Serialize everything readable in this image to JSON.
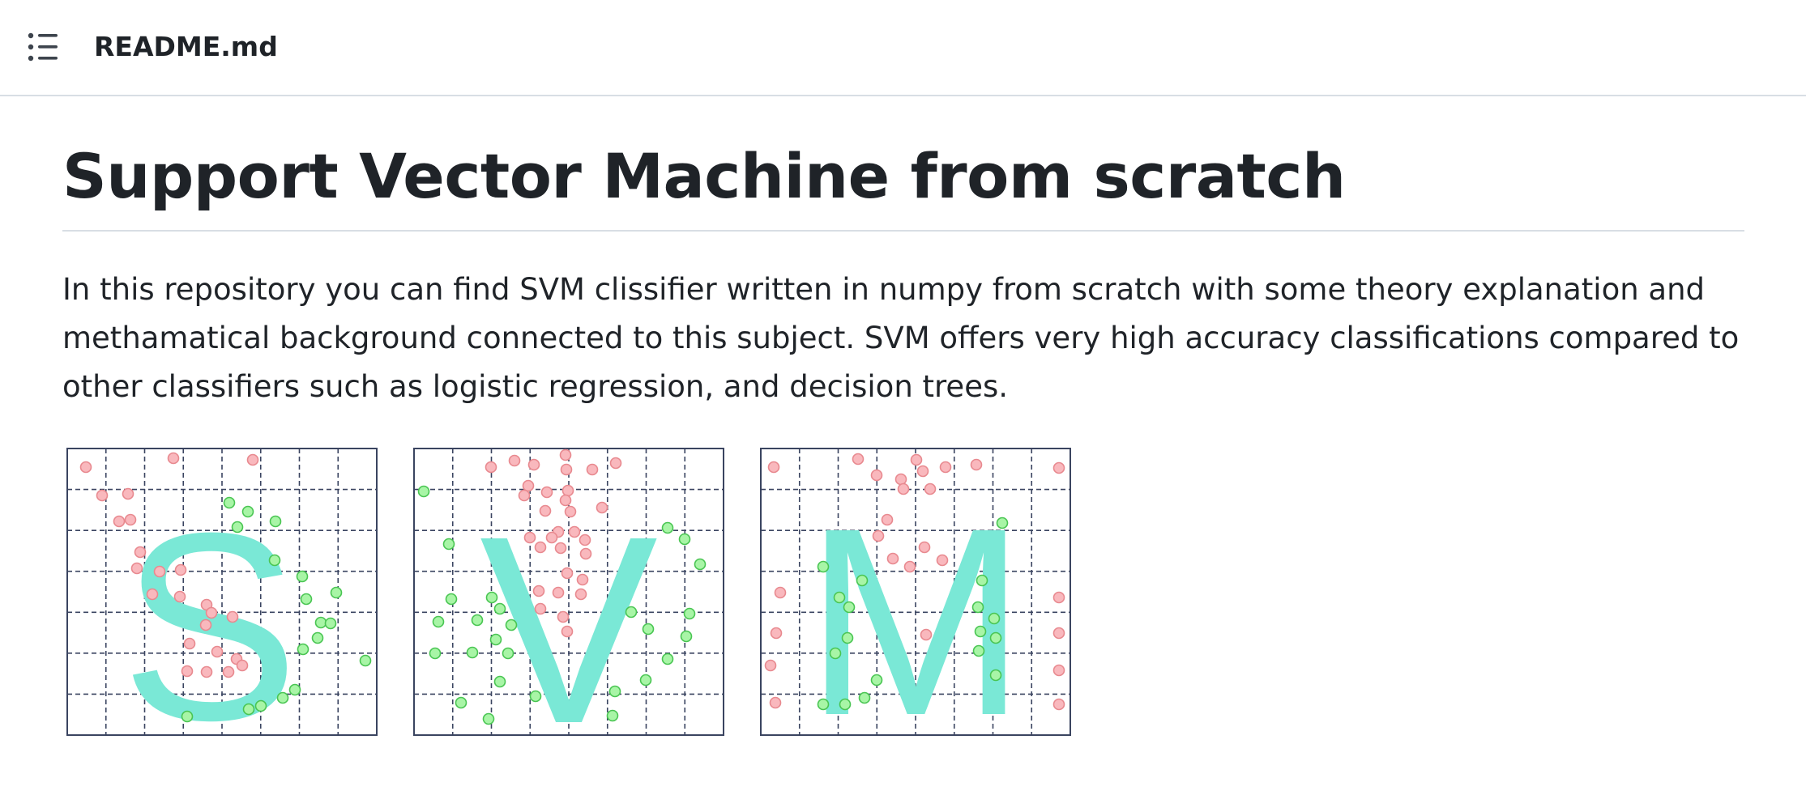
{
  "header": {
    "toc_icon": "list-icon",
    "file_name": "README.md"
  },
  "readme": {
    "title": "Support Vector Machine from scratch",
    "description": "In this repository you can find SVM clissifier written in numpy from scratch with some theory explanation and methamatical background connected to this subject. SVM offers very high accuracy classifications compared to other classifiers such as logistic regression, and decision trees.",
    "banner": {
      "letters": [
        "S",
        "V",
        "M"
      ],
      "colors": {
        "letter": "#7ae8d6",
        "class_a_fill": "#f9b8bd",
        "class_a_stroke": "#e8898f",
        "class_b_fill": "#a8f5a6",
        "class_b_stroke": "#49c552",
        "grid": "#3a4460"
      }
    }
  }
}
